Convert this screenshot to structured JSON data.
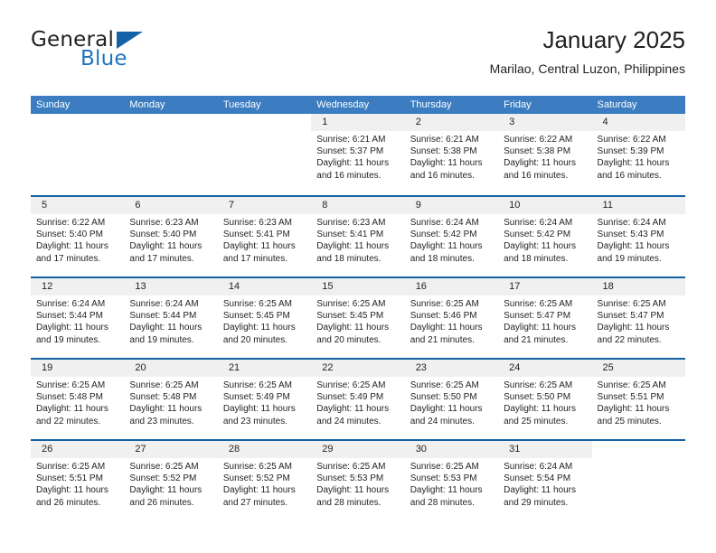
{
  "brand": {
    "name_part1": "General",
    "name_part2": "Blue"
  },
  "header": {
    "title": "January 2025",
    "subtitle": "Marilao, Central Luzon, Philippines"
  },
  "weekdays": [
    "Sunday",
    "Monday",
    "Tuesday",
    "Wednesday",
    "Thursday",
    "Friday",
    "Saturday"
  ],
  "colors": {
    "header_blue": "#3b7dc0",
    "rule_blue": "#1361a6",
    "band_gray": "#f0f0f0",
    "text": "#231f20",
    "logo_blue": "#1f74bd"
  },
  "weeks": [
    [
      {
        "day": "",
        "sunrise": "",
        "sunset": "",
        "daylight": "",
        "empty": true
      },
      {
        "day": "",
        "sunrise": "",
        "sunset": "",
        "daylight": "",
        "empty": true
      },
      {
        "day": "",
        "sunrise": "",
        "sunset": "",
        "daylight": "",
        "empty": true
      },
      {
        "day": "1",
        "sunrise": "Sunrise: 6:21 AM",
        "sunset": "Sunset: 5:37 PM",
        "daylight": "Daylight: 11 hours and 16 minutes.",
        "empty": false
      },
      {
        "day": "2",
        "sunrise": "Sunrise: 6:21 AM",
        "sunset": "Sunset: 5:38 PM",
        "daylight": "Daylight: 11 hours and 16 minutes.",
        "empty": false
      },
      {
        "day": "3",
        "sunrise": "Sunrise: 6:22 AM",
        "sunset": "Sunset: 5:38 PM",
        "daylight": "Daylight: 11 hours and 16 minutes.",
        "empty": false
      },
      {
        "day": "4",
        "sunrise": "Sunrise: 6:22 AM",
        "sunset": "Sunset: 5:39 PM",
        "daylight": "Daylight: 11 hours and 16 minutes.",
        "empty": false
      }
    ],
    [
      {
        "day": "5",
        "sunrise": "Sunrise: 6:22 AM",
        "sunset": "Sunset: 5:40 PM",
        "daylight": "Daylight: 11 hours and 17 minutes.",
        "empty": false
      },
      {
        "day": "6",
        "sunrise": "Sunrise: 6:23 AM",
        "sunset": "Sunset: 5:40 PM",
        "daylight": "Daylight: 11 hours and 17 minutes.",
        "empty": false
      },
      {
        "day": "7",
        "sunrise": "Sunrise: 6:23 AM",
        "sunset": "Sunset: 5:41 PM",
        "daylight": "Daylight: 11 hours and 17 minutes.",
        "empty": false
      },
      {
        "day": "8",
        "sunrise": "Sunrise: 6:23 AM",
        "sunset": "Sunset: 5:41 PM",
        "daylight": "Daylight: 11 hours and 18 minutes.",
        "empty": false
      },
      {
        "day": "9",
        "sunrise": "Sunrise: 6:24 AM",
        "sunset": "Sunset: 5:42 PM",
        "daylight": "Daylight: 11 hours and 18 minutes.",
        "empty": false
      },
      {
        "day": "10",
        "sunrise": "Sunrise: 6:24 AM",
        "sunset": "Sunset: 5:42 PM",
        "daylight": "Daylight: 11 hours and 18 minutes.",
        "empty": false
      },
      {
        "day": "11",
        "sunrise": "Sunrise: 6:24 AM",
        "sunset": "Sunset: 5:43 PM",
        "daylight": "Daylight: 11 hours and 19 minutes.",
        "empty": false
      }
    ],
    [
      {
        "day": "12",
        "sunrise": "Sunrise: 6:24 AM",
        "sunset": "Sunset: 5:44 PM",
        "daylight": "Daylight: 11 hours and 19 minutes.",
        "empty": false
      },
      {
        "day": "13",
        "sunrise": "Sunrise: 6:24 AM",
        "sunset": "Sunset: 5:44 PM",
        "daylight": "Daylight: 11 hours and 19 minutes.",
        "empty": false
      },
      {
        "day": "14",
        "sunrise": "Sunrise: 6:25 AM",
        "sunset": "Sunset: 5:45 PM",
        "daylight": "Daylight: 11 hours and 20 minutes.",
        "empty": false
      },
      {
        "day": "15",
        "sunrise": "Sunrise: 6:25 AM",
        "sunset": "Sunset: 5:45 PM",
        "daylight": "Daylight: 11 hours and 20 minutes.",
        "empty": false
      },
      {
        "day": "16",
        "sunrise": "Sunrise: 6:25 AM",
        "sunset": "Sunset: 5:46 PM",
        "daylight": "Daylight: 11 hours and 21 minutes.",
        "empty": false
      },
      {
        "day": "17",
        "sunrise": "Sunrise: 6:25 AM",
        "sunset": "Sunset: 5:47 PM",
        "daylight": "Daylight: 11 hours and 21 minutes.",
        "empty": false
      },
      {
        "day": "18",
        "sunrise": "Sunrise: 6:25 AM",
        "sunset": "Sunset: 5:47 PM",
        "daylight": "Daylight: 11 hours and 22 minutes.",
        "empty": false
      }
    ],
    [
      {
        "day": "19",
        "sunrise": "Sunrise: 6:25 AM",
        "sunset": "Sunset: 5:48 PM",
        "daylight": "Daylight: 11 hours and 22 minutes.",
        "empty": false
      },
      {
        "day": "20",
        "sunrise": "Sunrise: 6:25 AM",
        "sunset": "Sunset: 5:48 PM",
        "daylight": "Daylight: 11 hours and 23 minutes.",
        "empty": false
      },
      {
        "day": "21",
        "sunrise": "Sunrise: 6:25 AM",
        "sunset": "Sunset: 5:49 PM",
        "daylight": "Daylight: 11 hours and 23 minutes.",
        "empty": false
      },
      {
        "day": "22",
        "sunrise": "Sunrise: 6:25 AM",
        "sunset": "Sunset: 5:49 PM",
        "daylight": "Daylight: 11 hours and 24 minutes.",
        "empty": false
      },
      {
        "day": "23",
        "sunrise": "Sunrise: 6:25 AM",
        "sunset": "Sunset: 5:50 PM",
        "daylight": "Daylight: 11 hours and 24 minutes.",
        "empty": false
      },
      {
        "day": "24",
        "sunrise": "Sunrise: 6:25 AM",
        "sunset": "Sunset: 5:50 PM",
        "daylight": "Daylight: 11 hours and 25 minutes.",
        "empty": false
      },
      {
        "day": "25",
        "sunrise": "Sunrise: 6:25 AM",
        "sunset": "Sunset: 5:51 PM",
        "daylight": "Daylight: 11 hours and 25 minutes.",
        "empty": false
      }
    ],
    [
      {
        "day": "26",
        "sunrise": "Sunrise: 6:25 AM",
        "sunset": "Sunset: 5:51 PM",
        "daylight": "Daylight: 11 hours and 26 minutes.",
        "empty": false
      },
      {
        "day": "27",
        "sunrise": "Sunrise: 6:25 AM",
        "sunset": "Sunset: 5:52 PM",
        "daylight": "Daylight: 11 hours and 26 minutes.",
        "empty": false
      },
      {
        "day": "28",
        "sunrise": "Sunrise: 6:25 AM",
        "sunset": "Sunset: 5:52 PM",
        "daylight": "Daylight: 11 hours and 27 minutes.",
        "empty": false
      },
      {
        "day": "29",
        "sunrise": "Sunrise: 6:25 AM",
        "sunset": "Sunset: 5:53 PM",
        "daylight": "Daylight: 11 hours and 28 minutes.",
        "empty": false
      },
      {
        "day": "30",
        "sunrise": "Sunrise: 6:25 AM",
        "sunset": "Sunset: 5:53 PM",
        "daylight": "Daylight: 11 hours and 28 minutes.",
        "empty": false
      },
      {
        "day": "31",
        "sunrise": "Sunrise: 6:24 AM",
        "sunset": "Sunset: 5:54 PM",
        "daylight": "Daylight: 11 hours and 29 minutes.",
        "empty": false
      },
      {
        "day": "",
        "sunrise": "",
        "sunset": "",
        "daylight": "",
        "empty": true
      }
    ]
  ]
}
